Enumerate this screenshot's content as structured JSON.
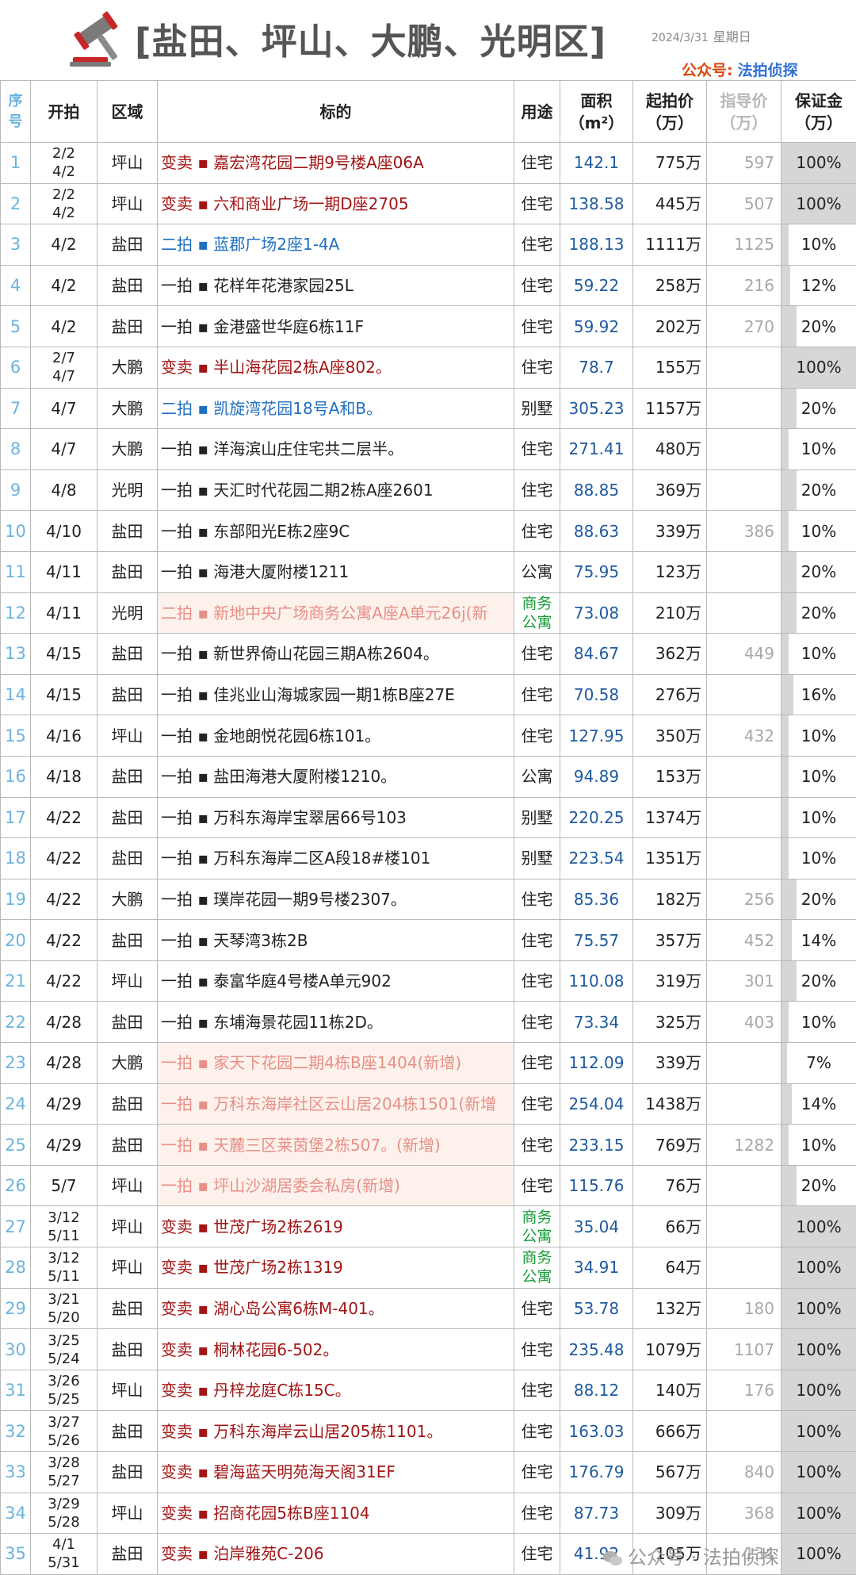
{
  "header": {
    "title": "[盐田、坪山、大鹏、光明区]",
    "date": "2024/3/31",
    "weekday": "星期日",
    "account_label": "公众号:",
    "account_name": "法拍侦探"
  },
  "columns": {
    "seq": "序号",
    "start": "开拍",
    "district": "区域",
    "item": "标的",
    "use": "用途",
    "area_line1": "面积",
    "area_line2": "（m²）",
    "price_line1": "起拍价",
    "price_line2": "（万）",
    "guide_line1": "指导价",
    "guide_line2": "（万）",
    "deposit_line1": "保证金",
    "deposit_line2": "（万）"
  },
  "rows": [
    {
      "seq": "1",
      "d1": "2/2",
      "d2": "4/2",
      "district": "坪山",
      "item": "变卖 ▪ 嘉宏湾花园二期9号楼A座06A",
      "style": "red",
      "use": "住宅",
      "area": "142.1",
      "price": "775万",
      "guide": "597",
      "deposit": "100%",
      "dep_level": 1.0
    },
    {
      "seq": "2",
      "d1": "2/2",
      "d2": "4/2",
      "district": "坪山",
      "item": "变卖 ▪ 六和商业广场一期D座2705",
      "style": "red",
      "use": "住宅",
      "area": "138.58",
      "price": "445万",
      "guide": "507",
      "deposit": "100%",
      "dep_level": 1.0
    },
    {
      "seq": "3",
      "d1": "4/2",
      "d2": "",
      "district": "盐田",
      "item": "二拍 ▪ 蓝郡广场2座1-4A",
      "style": "blue",
      "use": "住宅",
      "area": "188.13",
      "price": "1111万",
      "guide": "1125",
      "deposit": "10%",
      "dep_level": 0.1
    },
    {
      "seq": "4",
      "d1": "4/2",
      "d2": "",
      "district": "盐田",
      "item": "一拍 ▪ 花样年花港家园25L",
      "style": "black",
      "use": "住宅",
      "area": "59.22",
      "price": "258万",
      "guide": "216",
      "deposit": "12%",
      "dep_level": 0.12
    },
    {
      "seq": "5",
      "d1": "4/2",
      "d2": "",
      "district": "盐田",
      "item": "一拍 ▪ 金港盛世华庭6栋11F",
      "style": "black",
      "use": "住宅",
      "area": "59.92",
      "price": "202万",
      "guide": "270",
      "deposit": "20%",
      "dep_level": 0.2
    },
    {
      "seq": "6",
      "d1": "2/7",
      "d2": "4/7",
      "district": "大鹏",
      "item": "变卖 ▪ 半山海花园2栋A座802。",
      "style": "red",
      "use": "住宅",
      "area": "78.7",
      "price": "155万",
      "guide": "",
      "deposit": "100%",
      "dep_level": 1.0
    },
    {
      "seq": "7",
      "d1": "4/7",
      "d2": "",
      "district": "大鹏",
      "item": "二拍 ▪ 凯旋湾花园18号A和B。",
      "style": "blue",
      "use": "别墅",
      "area": "305.23",
      "price": "1157万",
      "guide": "",
      "deposit": "20%",
      "dep_level": 0.2
    },
    {
      "seq": "8",
      "d1": "4/7",
      "d2": "",
      "district": "大鹏",
      "item": "一拍 ▪ 洋海滨山庄住宅共二层半。",
      "style": "black",
      "use": "住宅",
      "area": "271.41",
      "price": "480万",
      "guide": "",
      "deposit": "10%",
      "dep_level": 0.1
    },
    {
      "seq": "9",
      "d1": "4/8",
      "d2": "",
      "district": "光明",
      "item": "一拍 ▪ 天汇时代花园二期2栋A座2601",
      "style": "black",
      "use": "住宅",
      "area": "88.85",
      "price": "369万",
      "guide": "",
      "deposit": "20%",
      "dep_level": 0.2
    },
    {
      "seq": "10",
      "d1": "4/10",
      "d2": "",
      "district": "盐田",
      "item": "一拍 ▪ 东部阳光E栋2座9C",
      "style": "black",
      "use": "住宅",
      "area": "88.63",
      "price": "339万",
      "guide": "386",
      "deposit": "10%",
      "dep_level": 0.1
    },
    {
      "seq": "11",
      "d1": "4/11",
      "d2": "",
      "district": "盐田",
      "item": "一拍 ▪ 海港大厦附楼1211",
      "style": "black",
      "use": "公寓",
      "area": "75.95",
      "price": "123万",
      "guide": "",
      "deposit": "20%",
      "dep_level": 0.2
    },
    {
      "seq": "12",
      "d1": "4/11",
      "d2": "",
      "district": "光明",
      "item": "二拍 ▪ 新地中央广场商务公寓A座A单元26j(新",
      "style": "pink",
      "use": "商务公寓",
      "area": "73.08",
      "price": "210万",
      "guide": "",
      "deposit": "20%",
      "dep_level": 0.2
    },
    {
      "seq": "13",
      "d1": "4/15",
      "d2": "",
      "district": "盐田",
      "item": "一拍 ▪ 新世界倚山花园三期A栋2604。",
      "style": "black",
      "use": "住宅",
      "area": "84.67",
      "price": "362万",
      "guide": "449",
      "deposit": "10%",
      "dep_level": 0.1
    },
    {
      "seq": "14",
      "d1": "4/15",
      "d2": "",
      "district": "盐田",
      "item": "一拍 ▪ 佳兆业山海城家园一期1栋B座27E",
      "style": "black",
      "use": "住宅",
      "area": "70.58",
      "price": "276万",
      "guide": "",
      "deposit": "16%",
      "dep_level": 0.16
    },
    {
      "seq": "15",
      "d1": "4/16",
      "d2": "",
      "district": "坪山",
      "item": "一拍 ▪ 金地朗悦花园6栋101。",
      "style": "black",
      "use": "住宅",
      "area": "127.95",
      "price": "350万",
      "guide": "432",
      "deposit": "10%",
      "dep_level": 0.1
    },
    {
      "seq": "16",
      "d1": "4/18",
      "d2": "",
      "district": "盐田",
      "item": "一拍 ▪ 盐田海港大厦附楼1210。",
      "style": "black",
      "use": "公寓",
      "area": "94.89",
      "price": "153万",
      "guide": "",
      "deposit": "10%",
      "dep_level": 0.1
    },
    {
      "seq": "17",
      "d1": "4/22",
      "d2": "",
      "district": "盐田",
      "item": "一拍 ▪ 万科东海岸宝翠居66号103",
      "style": "black",
      "use": "别墅",
      "area": "220.25",
      "price": "1374万",
      "guide": "",
      "deposit": "10%",
      "dep_level": 0.1
    },
    {
      "seq": "18",
      "d1": "4/22",
      "d2": "",
      "district": "盐田",
      "item": "一拍 ▪ 万科东海岸二区A段18#楼101",
      "style": "black",
      "use": "别墅",
      "area": "223.54",
      "price": "1351万",
      "guide": "",
      "deposit": "10%",
      "dep_level": 0.1
    },
    {
      "seq": "19",
      "d1": "4/22",
      "d2": "",
      "district": "大鹏",
      "item": "一拍 ▪ 璞岸花园一期9号楼2307。",
      "style": "black",
      "use": "住宅",
      "area": "85.36",
      "price": "182万",
      "guide": "256",
      "deposit": "20%",
      "dep_level": 0.2
    },
    {
      "seq": "20",
      "d1": "4/22",
      "d2": "",
      "district": "盐田",
      "item": "一拍 ▪ 天琴湾3栋2B",
      "style": "black",
      "use": "住宅",
      "area": "75.57",
      "price": "357万",
      "guide": "452",
      "deposit": "14%",
      "dep_level": 0.14
    },
    {
      "seq": "21",
      "d1": "4/22",
      "d2": "",
      "district": "坪山",
      "item": "一拍 ▪ 泰富华庭4号楼A单元902",
      "style": "black",
      "use": "住宅",
      "area": "110.08",
      "price": "319万",
      "guide": "301",
      "deposit": "20%",
      "dep_level": 0.2
    },
    {
      "seq": "22",
      "d1": "4/28",
      "d2": "",
      "district": "盐田",
      "item": "一拍 ▪ 东埔海景花园11栋2D。",
      "style": "black",
      "use": "住宅",
      "area": "73.34",
      "price": "325万",
      "guide": "403",
      "deposit": "10%",
      "dep_level": 0.1
    },
    {
      "seq": "23",
      "d1": "4/28",
      "d2": "",
      "district": "大鹏",
      "item": "一拍 ▪ 家天下花园二期4栋B座1404(新增)",
      "style": "pink",
      "use": "住宅",
      "area": "112.09",
      "price": "339万",
      "guide": "",
      "deposit": "7%",
      "dep_level": 0.07
    },
    {
      "seq": "24",
      "d1": "4/29",
      "d2": "",
      "district": "盐田",
      "item": "一拍 ▪ 万科东海岸社区云山居204栋1501(新增",
      "style": "pink",
      "use": "住宅",
      "area": "254.04",
      "price": "1438万",
      "guide": "",
      "deposit": "14%",
      "dep_level": 0.14
    },
    {
      "seq": "25",
      "d1": "4/29",
      "d2": "",
      "district": "盐田",
      "item": "一拍 ▪ 天麓三区莱茵堡2栋507。(新增)",
      "style": "pink",
      "use": "住宅",
      "area": "233.15",
      "price": "769万",
      "guide": "1282",
      "deposit": "10%",
      "dep_level": 0.1
    },
    {
      "seq": "26",
      "d1": "5/7",
      "d2": "",
      "district": "坪山",
      "item": "一拍 ▪ 坪山沙湖居委会私房(新增)",
      "style": "pink",
      "use": "住宅",
      "area": "115.76",
      "price": "76万",
      "guide": "",
      "deposit": "20%",
      "dep_level": 0.2
    },
    {
      "seq": "27",
      "d1": "3/12",
      "d2": "5/11",
      "district": "坪山",
      "item": "变卖 ▪ 世茂广场2栋2619",
      "style": "red",
      "use": "商务公寓",
      "area": "35.04",
      "price": "66万",
      "guide": "",
      "deposit": "100%",
      "dep_level": 1.0
    },
    {
      "seq": "28",
      "d1": "3/12",
      "d2": "5/11",
      "district": "坪山",
      "item": "变卖 ▪ 世茂广场2栋1319",
      "style": "red",
      "use": "商务公寓",
      "area": "34.91",
      "price": "64万",
      "guide": "",
      "deposit": "100%",
      "dep_level": 1.0
    },
    {
      "seq": "29",
      "d1": "3/21",
      "d2": "5/20",
      "district": "盐田",
      "item": "变卖 ▪ 湖心岛公寓6栋M-401。",
      "style": "red",
      "use": "住宅",
      "area": "53.78",
      "price": "132万",
      "guide": "180",
      "deposit": "100%",
      "dep_level": 1.0
    },
    {
      "seq": "30",
      "d1": "3/25",
      "d2": "5/24",
      "district": "盐田",
      "item": "变卖 ▪ 桐林花园6-502。",
      "style": "red",
      "use": "住宅",
      "area": "235.48",
      "price": "1079万",
      "guide": "1107",
      "deposit": "100%",
      "dep_level": 1.0
    },
    {
      "seq": "31",
      "d1": "3/26",
      "d2": "5/25",
      "district": "坪山",
      "item": "变卖 ▪ 丹梓龙庭C栋15C。",
      "style": "red",
      "use": "住宅",
      "area": "88.12",
      "price": "140万",
      "guide": "176",
      "deposit": "100%",
      "dep_level": 1.0
    },
    {
      "seq": "32",
      "d1": "3/27",
      "d2": "5/26",
      "district": "盐田",
      "item": "变卖 ▪ 万科东海岸云山居205栋1101。",
      "style": "red",
      "use": "住宅",
      "area": "163.03",
      "price": "666万",
      "guide": "",
      "deposit": "100%",
      "dep_level": 1.0
    },
    {
      "seq": "33",
      "d1": "3/28",
      "d2": "5/27",
      "district": "盐田",
      "item": "变卖 ▪ 碧海蓝天明苑海天阁31EF",
      "style": "red",
      "use": "住宅",
      "area": "176.79",
      "price": "567万",
      "guide": "840",
      "deposit": "100%",
      "dep_level": 1.0
    },
    {
      "seq": "34",
      "d1": "3/29",
      "d2": "5/28",
      "district": "坪山",
      "item": "变卖 ▪ 招商花园5栋B座1104",
      "style": "red",
      "use": "住宅",
      "area": "87.73",
      "price": "309万",
      "guide": "368",
      "deposit": "100%",
      "dep_level": 1.0
    },
    {
      "seq": "35",
      "d1": "4/1",
      "d2": "5/31",
      "district": "盐田",
      "item": "变卖 ▪ 泊岸雅苑C-206",
      "style": "red",
      "use": "住宅",
      "area": "41.92",
      "price": "105万",
      "guide": "134",
      "deposit": "100%",
      "dep_level": 1.0
    }
  ],
  "watermark": "公众号 · 法拍侦探",
  "colors": {
    "seq_blue": "#6cb3dd",
    "sale_red": "#a31515",
    "second_blue": "#1f6fc0",
    "new_pink": "#e88f86",
    "biz_green": "#1a9d3a",
    "account_orange": "#d9480f",
    "account_blue": "#2f6fd6"
  },
  "icons": {
    "logo": "gavel-icon",
    "watermark": "wechat-icon"
  }
}
